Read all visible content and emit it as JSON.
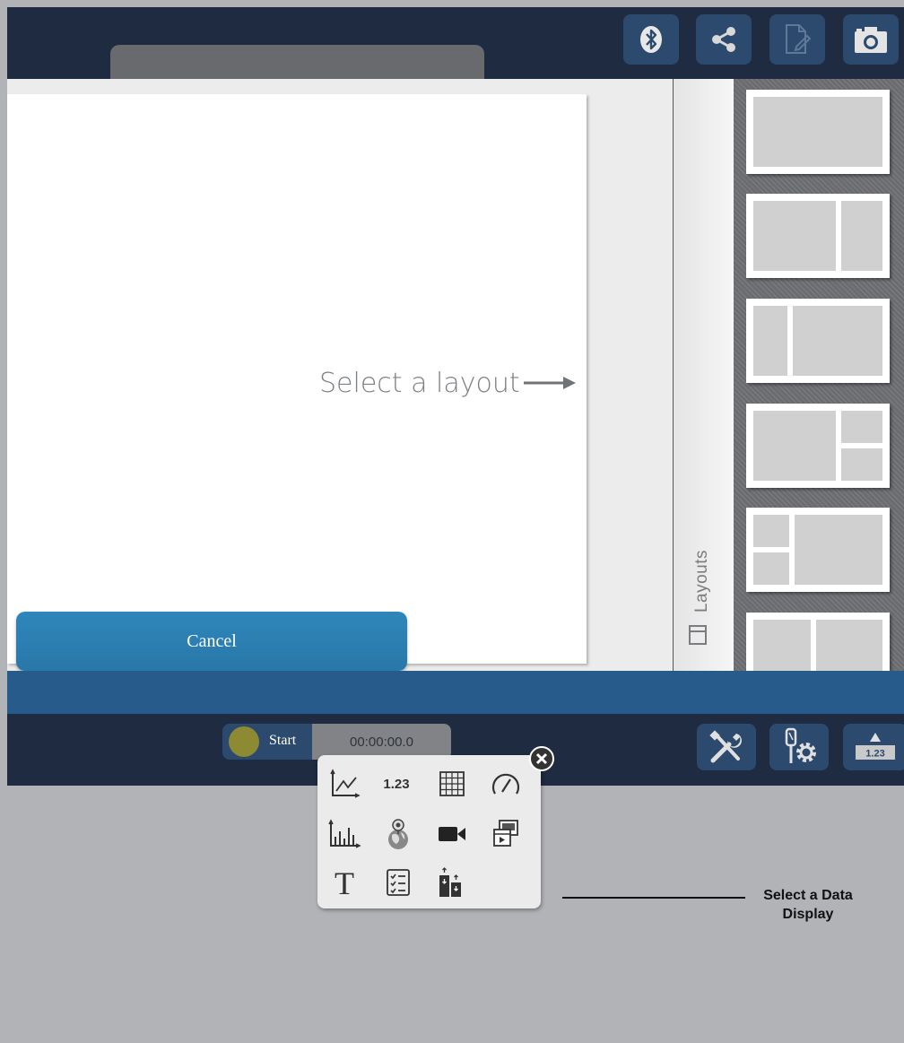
{
  "header": {
    "buttons": [
      {
        "name": "bluetooth",
        "icon": "bluetooth-icon"
      },
      {
        "name": "share",
        "icon": "share-icon"
      },
      {
        "name": "export",
        "icon": "document-edit-icon"
      },
      {
        "name": "snapshot",
        "icon": "camera-icon"
      }
    ]
  },
  "canvas": {
    "prompt": "Select a layout",
    "cancel_label": "Cancel"
  },
  "layouts": {
    "label": "Layouts",
    "options": [
      "full",
      "wide-left-narrow-right",
      "narrow-left-wide-right",
      "wide-left-two-stacked-right",
      "two-stacked-left-wide-right",
      "two-columns"
    ]
  },
  "toolbar": {
    "start_label": "Start",
    "timer": "00:00:00.0",
    "meter_badge": "1.23",
    "buttons": [
      {
        "name": "tools",
        "icon": "wrench-screwdriver-icon"
      },
      {
        "name": "sensor-settings",
        "icon": "sensor-gear-icon"
      },
      {
        "name": "meter",
        "icon": "meter-icon"
      }
    ]
  },
  "data_display": {
    "digits_label": "1.23",
    "callout": "Select a Data Display",
    "items": [
      "graph",
      "digits",
      "table",
      "gauge",
      "bar-graph",
      "map",
      "video",
      "image",
      "text",
      "checklist",
      "group-bars"
    ]
  },
  "colors": {
    "dark_bar": "#1e2b40",
    "button_blue": "#2c4a6d",
    "accent_blue": "#2f86bb",
    "divider_blue": "#275b8b",
    "backdrop": "#b1b3b6"
  }
}
